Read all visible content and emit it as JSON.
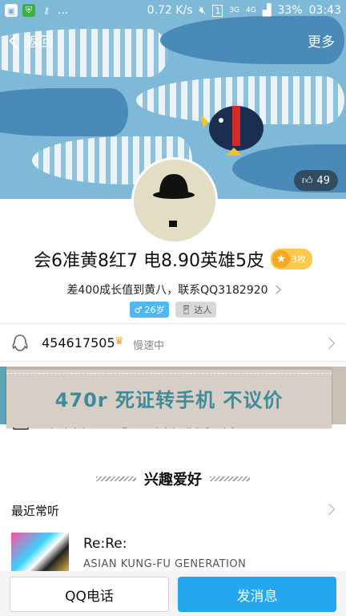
{
  "status_bar": {
    "speed": "0.72 K/s",
    "sim": "1",
    "net_3g": "3G",
    "net_4g": "4G",
    "battery": "33%",
    "time": "03:43",
    "dots": "..."
  },
  "header": {
    "back_label": "返回",
    "more_label": "更多",
    "likes": "49"
  },
  "profile": {
    "nickname": "会6准黄8红7 电8.90英雄5皮",
    "medal_count": "3枚",
    "signature": "差400成长值到黄八，联系QQ3182920",
    "age_tag": "26岁",
    "expert_tag": "达人",
    "qq_number": "454617505",
    "qq_status": "慢速中"
  },
  "ad": {
    "text": "470r 死证转手机 不议价"
  },
  "partially_hidden_row": {
    "text": "会6准黄8红7 电8.90英雄5皮的空间"
  },
  "interests": {
    "title": "兴趣爱好",
    "recent_label": "最近常听",
    "song_title": "Re:Re:",
    "song_artist": "ASIAN KUNG-FU GENERATION"
  },
  "actions": {
    "call_label": "QQ电话",
    "message_label": "发消息"
  },
  "colors": {
    "accent": "#25a7f0",
    "banner": "#7fb9d8",
    "medal": "#f8c94a"
  }
}
